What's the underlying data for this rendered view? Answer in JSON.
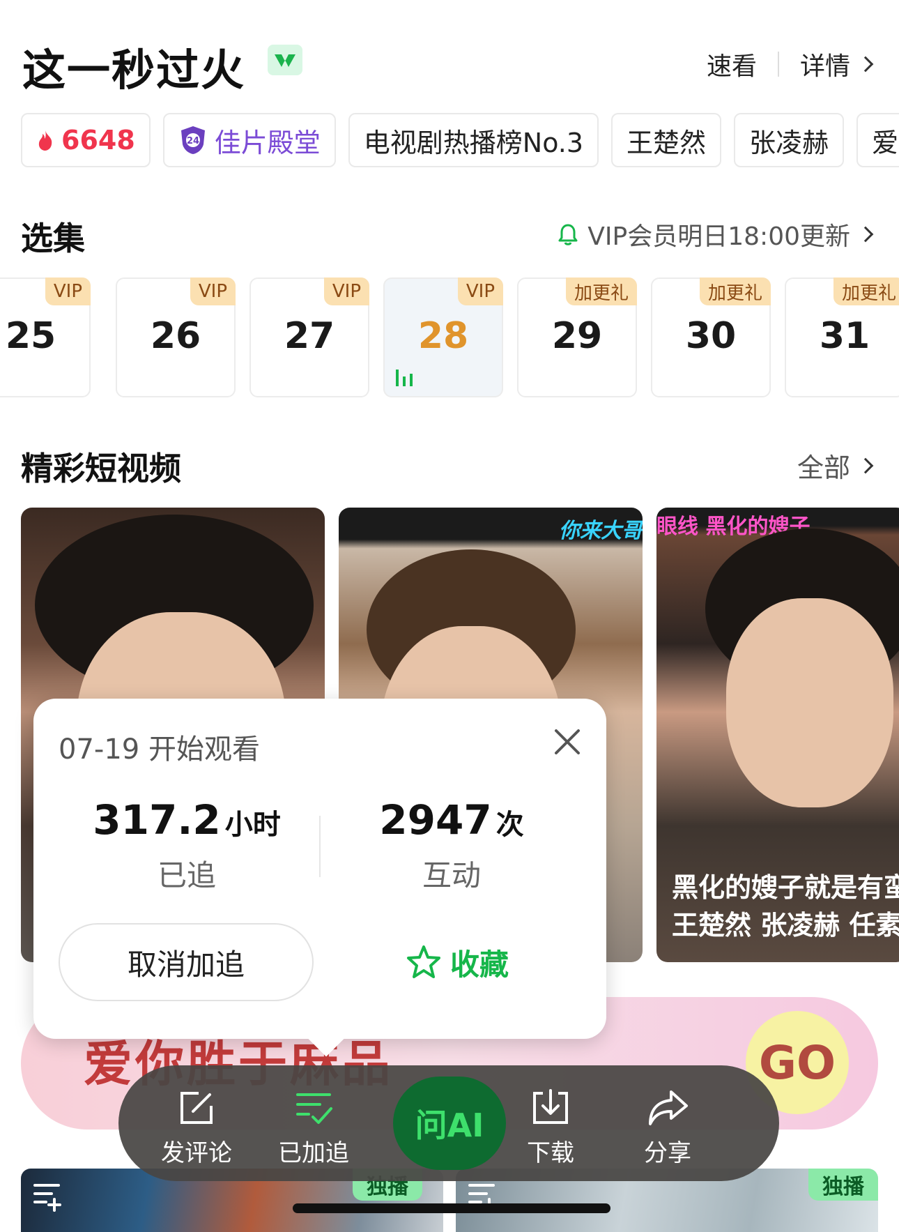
{
  "header": {
    "title": "这一秒过火",
    "quick_view": "速看",
    "details": "详情"
  },
  "tags": {
    "heat": "6648",
    "award": "佳片殿堂",
    "rank": "电视剧热播榜No.3",
    "actor1": "王楚然",
    "actor2": "张凌赫",
    "genre": "爱情"
  },
  "episodes": {
    "title": "选集",
    "update_notice": "VIP会员明日18:00更新",
    "items": [
      {
        "num": "25",
        "badge": "VIP"
      },
      {
        "num": "26",
        "badge": "VIP"
      },
      {
        "num": "27",
        "badge": "VIP"
      },
      {
        "num": "28",
        "badge": "VIP"
      },
      {
        "num": "29",
        "badge": "加更礼"
      },
      {
        "num": "30",
        "badge": "加更礼"
      },
      {
        "num": "31",
        "badge": "加更礼"
      }
    ],
    "current": "28"
  },
  "shorts": {
    "title": "精彩短视频",
    "all": "全部",
    "v2_caption": "你来大哥",
    "v3_caption": "眼线 黑化的嫂子",
    "v3_line1": "黑化的嫂子就是有蛮",
    "v3_line2": "王楚然 张凌赫 任素"
  },
  "banner": {
    "text": "爱你胜于麻品",
    "go": "GO"
  },
  "popup": {
    "date": "07-19 开始观看",
    "hours_value": "317.2",
    "hours_unit": "小时",
    "hours_label": "已追",
    "interactions_value": "2947",
    "interactions_unit": "次",
    "interactions_label": "互动",
    "cancel": "取消加追",
    "favorite": "收藏"
  },
  "actions": {
    "comment": "发评论",
    "followed": "已加追",
    "ask_ai": "问AI",
    "download": "下载",
    "share": "分享"
  },
  "thumbs": {
    "exclusive": "独播"
  },
  "colors": {
    "accent_green": "#16b64a",
    "hot_red": "#f0354d",
    "award_purple": "#7b4bd6",
    "vip_gold": "#e0942c"
  }
}
